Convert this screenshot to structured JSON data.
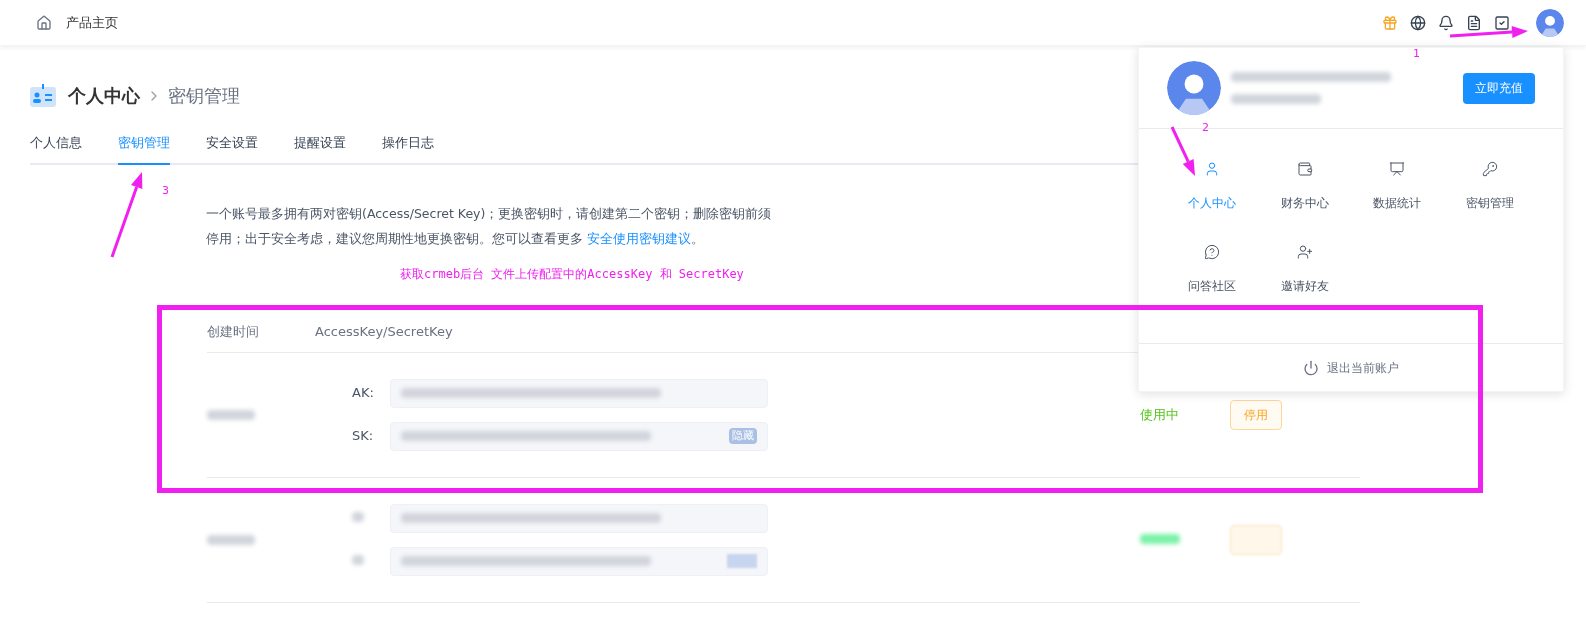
{
  "top_bar": {
    "home_label": "产品主页"
  },
  "breadcrumb": {
    "parent": "个人中心",
    "current": "密钥管理"
  },
  "tabs": [
    {
      "label": "个人信息",
      "selected": false
    },
    {
      "label": "密钥管理",
      "selected": true
    },
    {
      "label": "安全设置",
      "selected": false
    },
    {
      "label": "提醒设置",
      "selected": false
    },
    {
      "label": "操作日志",
      "selected": false
    }
  ],
  "notice": {
    "text": "一个账号最多拥有两对密钥(Access/Secret Key)；更换密钥时，请创建第二个密钥；删除密钥前须停用；出于安全考虑，建议您周期性地更换密钥。您可以查看更多 ",
    "link": "安全使用密钥建议",
    "end": "。"
  },
  "annotation": {
    "caption": "获取crmeb后台 文件上传配置中的AccessKey 和 SecretKey",
    "markers": [
      "1",
      "2",
      "3"
    ]
  },
  "table": {
    "columns": [
      "创建时间",
      "AccessKey/SecretKey"
    ],
    "rows": [
      {
        "kind": "visible",
        "keys": [
          {
            "label": "AK:"
          },
          {
            "label": "SK:",
            "toggle": "隐藏"
          }
        ],
        "status": "使用中",
        "action": "停用"
      },
      {
        "kind": "blurred"
      }
    ]
  },
  "account_menu": {
    "recharge": "立即充值",
    "items": [
      {
        "label": "个人中心",
        "selected": true
      },
      {
        "label": "财务中心",
        "selected": false
      },
      {
        "label": "数据统计",
        "selected": false
      },
      {
        "label": "密钥管理",
        "selected": false
      },
      {
        "label": "问答社区",
        "selected": false
      },
      {
        "label": "邀请好友",
        "selected": false
      }
    ],
    "logout": "退出当前账户"
  }
}
